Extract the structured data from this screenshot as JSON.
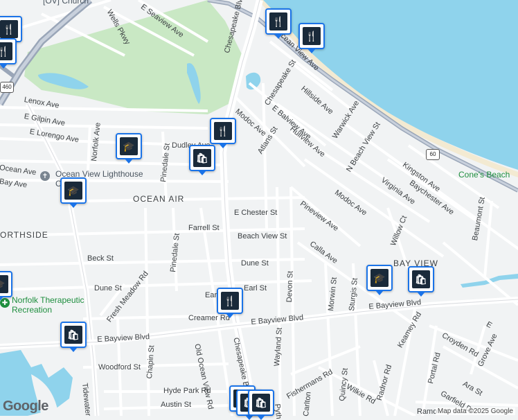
{
  "map": {
    "neighborhoods": [
      "OCEAN AIR",
      "BAY VIEW",
      "ORTHSIDE"
    ],
    "places": [
      "Ocean View Lighthouse Church",
      "Norfolk Therapeutic Recreation",
      "Cone's Beach",
      "[OV] Church"
    ],
    "streets": {
      "chesapeake_blvd": "Chesapeake Blvd",
      "chesapeake_blvd_south": "Chesapeake Blvd",
      "ocean_view_ave": "Ocean View Ave",
      "wells_pkwy": "Wells Pkwy",
      "e_seaview_ave": "E Seaview Ave",
      "lenox_ave": "Lenox Ave",
      "e_gilpin_ave": "E Gilpin Ave",
      "e_lorengo_ave": "E Lorengo Ave",
      "norfolk_ave": "Norfolk Ave",
      "dudley_ave": "Dudley Ave",
      "pinedale_st_north": "Pinedale St",
      "ocean_ave": "Ocean Ave",
      "bay_ave": "Bay Ave",
      "chesapeake_st": "Chesapeake St",
      "hillside_ave": "Hillside Ave",
      "e_balview_ave": "E Balview Ave",
      "warwick_ave": "Warwick Ave",
      "modoc_ave_north": "Modoc Ave",
      "atlans_st": "Atlans St",
      "hullview_ave": "Hullview Ave",
      "n_beach_view_st": "N Beach View St",
      "kingston_ave": "Kingston Ave",
      "baychester_ave": "Baychester Ave",
      "virginia_ave": "Virginia Ave",
      "modoc_ave_south": "Modoc Ave",
      "e_chester_st": "E Chester St",
      "pineview_ave": "Pineview Ave",
      "farrell_st": "Farrell St",
      "beach_view_st": "Beach View St",
      "willow_ct": "Willow Ct",
      "beaumont_st": "Beaumont St",
      "calla_ave": "Calla Ave",
      "beck_st": "Beck St",
      "pinedale_st_south": "Pinedale St",
      "dune_st_east": "Dune St",
      "dune_st_west": "Dune St",
      "fresh_meadow_rd": "Fresh Meadow Rd",
      "earl_st_west": "Earl",
      "earl_st_east": "Earl St",
      "devon_st": "Devon St",
      "morwin_st": "Morwin St",
      "sturgis_st": "Sturgis St",
      "creamer_rd": "Creamer Rd",
      "e_bayview_blvd_mid": "E Bayview Blvd",
      "e_bayview_blvd_west": "E Bayview Blvd",
      "e_bayview_blvd_east": "E Bayview Blvd",
      "e_bayview_blvd_far": "E",
      "keamey_rd": "Keamey Rd",
      "croyden_rd": "Croyden Rd",
      "grove_ave": "Grove Ave",
      "chapin_st": "Chapin St",
      "old_ocean_view_rd": "Old Ocean View Rd",
      "wayland_st": "Wayland St",
      "woodford_st": "Woodford St",
      "fishermans_rd": "Fishermans Rd",
      "quincy_st": "Quincy St",
      "wilkie_rd": "Wilkie Rd",
      "radnor_rd": "Radnor Rd",
      "portal_rd": "Portal Rd",
      "ara_st": "Ara St",
      "garfield_dr": "Garfield Dr",
      "hyde_park_rd": "Hyde Park Rd",
      "austin_st": "Austin St",
      "tidewater": "Tidewater",
      "carlton": "Carlton",
      "pyth": "Pyth",
      "ramo": "Ramo"
    },
    "route_shields": [
      "460",
      "60"
    ],
    "pins": {
      "restaurant": "🍴",
      "school": "🎓",
      "shopping": "🛍"
    },
    "colors": {
      "water": "#8fd3ec",
      "park": "#c9e8c4",
      "pin_border": "#1a73e8",
      "highway": "#9aa6b8"
    }
  },
  "footer": {
    "logo": "Google",
    "attribution": "Map data ©2025 Google"
  }
}
